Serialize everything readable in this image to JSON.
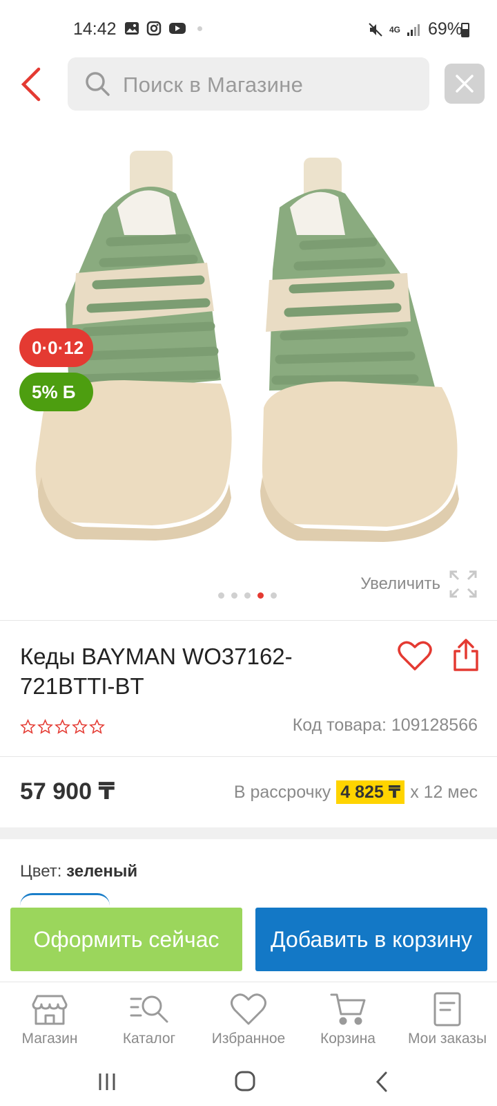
{
  "status_bar": {
    "time": "14:42",
    "network": "4G",
    "battery": "69%"
  },
  "search": {
    "placeholder": "Поиск в Магазине"
  },
  "product": {
    "badge_installment": "0·0·12",
    "badge_bonus": "5% Б",
    "zoom_label": "Увеличить",
    "gallery": {
      "count": 5,
      "active_index": 3
    },
    "title": "Кеды BAYMAN WO37162-721BTTI-BT",
    "rating": {
      "filled": 0,
      "max": 5
    },
    "sku": "Код товара: 109128566",
    "price": "57 900 ₸",
    "installment_prefix": "В рассрочку",
    "installment_amount": "4 825 ₸",
    "installment_suffix": "х 12 мес",
    "color_label": "Цвет:",
    "color_value": "зеленый"
  },
  "actions": {
    "checkout": "Оформить сейчас",
    "add_to_cart": "Добавить в корзину"
  },
  "bottom_nav": [
    {
      "label": "Магазин",
      "icon": "store-icon"
    },
    {
      "label": "Каталог",
      "icon": "catalog-search-icon"
    },
    {
      "label": "Избранное",
      "icon": "heart-icon"
    },
    {
      "label": "Корзина",
      "icon": "cart-icon"
    },
    {
      "label": "Мои заказы",
      "icon": "orders-icon"
    }
  ],
  "colors": {
    "accent_red": "#e43a32",
    "bonus_green": "#4d9e10",
    "checkout_green": "#9bd65c",
    "cart_blue": "#1378c6",
    "installment_yellow": "#ffd400"
  }
}
